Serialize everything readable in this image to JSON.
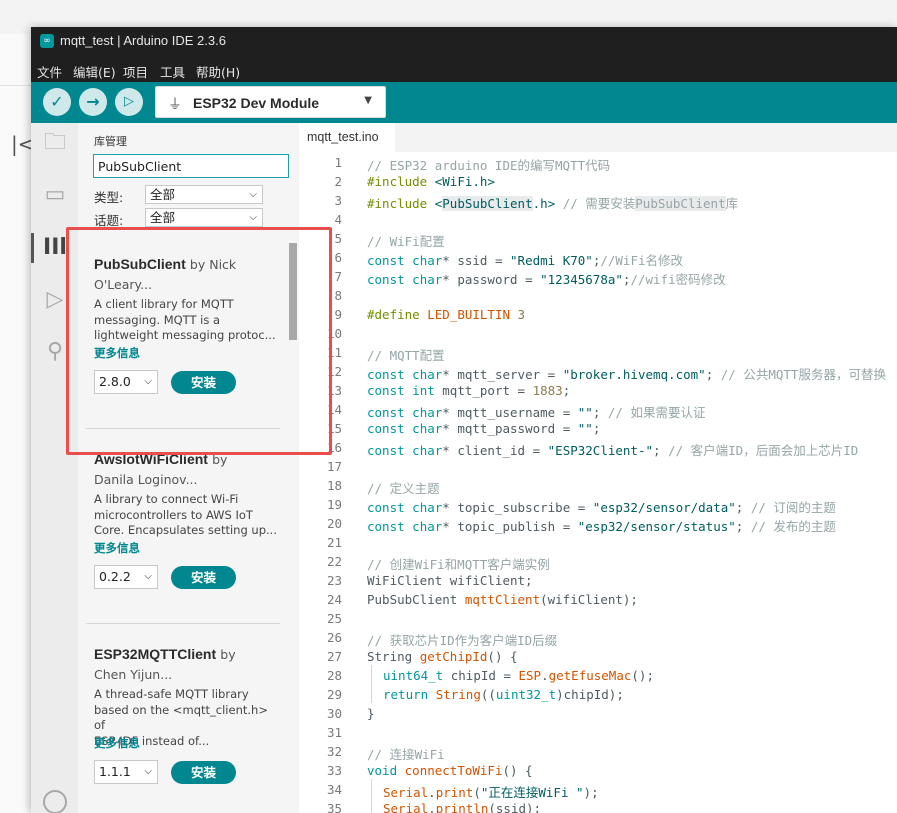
{
  "window": {
    "title": "mqtt_test | Arduino IDE 2.3.6",
    "logo_text": "∞"
  },
  "menu": [
    "文件",
    "编辑(E)",
    "项目",
    "工具",
    "帮助(H)"
  ],
  "toolbar": {
    "verify_icon": "check-icon",
    "upload_icon": "arrow-right-icon",
    "debug_icon": "debugger-icon",
    "board_name": "ESP32 Dev Module",
    "usb_icon": "usb-icon"
  },
  "library_manager": {
    "title": "库管理",
    "search_value": "PubSubClient",
    "type_label": "类型:",
    "type_value": "全部",
    "topic_label": "话题:",
    "topic_value": "全部",
    "more_info": "更多信息",
    "install_label": "安装",
    "libraries": [
      {
        "name": "PubSubClient",
        "by": "by Nick",
        "author": "O'Leary...",
        "desc": [
          "A client library for MQTT",
          "messaging. MQTT is a",
          "lightweight messaging protoc..."
        ],
        "version": "2.8.0"
      },
      {
        "name": "AwsIotWiFiClient",
        "by": "by",
        "author": "Danila Loginov...",
        "desc": [
          "A library to connect Wi-Fi",
          "microcontrollers to AWS IoT",
          "Core. Encapsulates setting up..."
        ],
        "version": "0.2.2"
      },
      {
        "name": "ESP32MQTTClient",
        "by": "by",
        "author": "Chen Yijun...",
        "desc": [
          "A thread-safe MQTT library",
          "based on the <mqtt_client.h> of",
          "ESP-IDF instead of..."
        ],
        "version": "1.1.1"
      }
    ]
  },
  "editor": {
    "tab": "mqtt_test.ino",
    "line_numbers": [
      "1",
      "2",
      "3",
      "4",
      "5",
      "6",
      "7",
      "8",
      "9",
      "10",
      "11",
      "12",
      "13",
      "14",
      "15",
      "16",
      "17",
      "18",
      "19",
      "20",
      "21",
      "22",
      "23",
      "24",
      "25",
      "26",
      "27",
      "28",
      "29",
      "30",
      "31",
      "32",
      "33",
      "34",
      "35"
    ],
    "code": {
      "l1": "// ESP32 arduino IDE的编写MQTT代码",
      "l2a": "#include",
      "l2b": " <WiFi.h>",
      "l3a": "#include",
      "l3b": " <",
      "l3c": "PubSubClient",
      "l3d": ".h>",
      "l3e": " // 需要安装",
      "l3f": "PubSubClient",
      "l3g": "库",
      "l5": "// WiFi配置",
      "l6a": "const",
      "l6b": " char",
      "l6c": "* ssid = ",
      "l6d": "\"Redmi K70\"",
      "l6e": ";",
      "l6f": "//WiFi名修改",
      "l7a": "const",
      "l7b": " char",
      "l7c": "* password = ",
      "l7d": "\"12345678a\"",
      "l7e": ";",
      "l7f": "//wifi密码修改",
      "l9a": "#define",
      "l9b": " LED_BUILTIN",
      "l9c": " 3",
      "l11": "// MQTT配置",
      "l12a": "const",
      "l12b": " char",
      "l12c": "* mqtt_server = ",
      "l12d": "\"broker.hivemq.com\"",
      "l12e": "; ",
      "l12f": "// 公共MQTT服务器，可替换",
      "l13a": "const",
      "l13b": " int",
      "l13c": " mqtt_port = ",
      "l13d": "1883",
      "l13e": ";",
      "l14a": "const",
      "l14b": " char",
      "l14c": "* mqtt_username = ",
      "l14d": "\"\"",
      "l14e": "; ",
      "l14f": "// 如果需要认证",
      "l15a": "const",
      "l15b": " char",
      "l15c": "* mqtt_password = ",
      "l15d": "\"\"",
      "l15e": ";",
      "l16a": "const",
      "l16b": " char",
      "l16c": "* client_id = ",
      "l16d": "\"ESP32Client-\"",
      "l16e": "; ",
      "l16f": "// 客户端ID，后面会加上芯片ID",
      "l18": "// 定义主题",
      "l19a": "const",
      "l19b": " char",
      "l19c": "* topic_subscribe = ",
      "l19d": "\"esp32/sensor/data\"",
      "l19e": "; ",
      "l19f": "// 订阅的主题",
      "l20a": "const",
      "l20b": " char",
      "l20c": "* topic_publish = ",
      "l20d": "\"esp32/sensor/status\"",
      "l20e": "; ",
      "l20f": "// 发布的主题",
      "l22": "// 创建WiFi和MQTT客户端实例",
      "l23": "WiFiClient wifiClient;",
      "l24a": "PubSubClient ",
      "l24b": "mqttClient",
      "l24c": "(wifiClient);",
      "l26": "// 获取芯片ID作为客户端ID后缀",
      "l27a": "String ",
      "l27b": "getChipId",
      "l27c": "() {",
      "l28a": "uint64_t",
      "l28b": " chipId = ",
      "l28c": "ESP",
      "l28d": ".",
      "l28e": "getEfuseMac",
      "l28f": "();",
      "l29a": "return",
      "l29b": " ",
      "l29c": "String",
      "l29d": "((",
      "l29e": "uint32_t",
      "l29f": ")chipId);",
      "l30": "}",
      "l32": "// 连接WiFi",
      "l33a": "void",
      "l33b": " ",
      "l33c": "connectToWiFi",
      "l33d": "() {",
      "l34a": "Serial",
      "l34b": ".",
      "l34c": "print",
      "l34d": "(",
      "l34e": "\"正在连接WiFi \"",
      "l34f": ");",
      "l35a": "Serial",
      "l35b": ".",
      "l35c": "println",
      "l35d": "(ssid);"
    }
  },
  "activity_icons": [
    "folder-icon",
    "board-manager-icon",
    "library-manager-icon",
    "debug-icon",
    "search-icon",
    "user-icon"
  ]
}
